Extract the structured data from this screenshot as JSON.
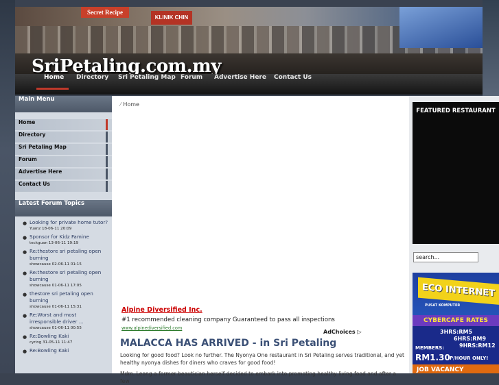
{
  "site": {
    "logo": "SriPetaling.com.my"
  },
  "header_signs": {
    "sign1": "Secret Recipe",
    "sign2": "KLINIK CHIN"
  },
  "nav": [
    {
      "label": "Home",
      "active": true
    },
    {
      "label": "Directory"
    },
    {
      "label": "Sri Petaling Map"
    },
    {
      "label": "Forum"
    },
    {
      "label": "Advertise Here"
    },
    {
      "label": "Contact Us"
    }
  ],
  "main_menu": {
    "heading": "Main Menu",
    "items": [
      "Home",
      "Directory",
      "Sri Petaling Map",
      "Forum",
      "Advertise Here",
      "Contact Us"
    ]
  },
  "forum": {
    "heading": "Latest Forum Topics",
    "topics": [
      {
        "title": "Looking for private home tutor?",
        "meta": "Yuanz 18-06-11 20:09"
      },
      {
        "title": "Sponsor for Kidz Famine",
        "meta": "teckguan 13-06-11 19:19"
      },
      {
        "title": "Re:thestore sri petaling open burning",
        "meta": "showcause 02-06-11 01:15"
      },
      {
        "title": "Re:thestore sri petaling open burning",
        "meta": "showcause 01-06-11 17:05"
      },
      {
        "title": "thestore sri petaling open burning",
        "meta": "showcause 01-06-11 15:31"
      },
      {
        "title": "Re:Worst and most irresponsible driver ...",
        "meta": "showcause 01-06-11 00:55"
      },
      {
        "title": "Re:Bowling Kaki",
        "meta": "cyring 31-05-11 11:47"
      },
      {
        "title": "Re:Bowling Kaki",
        "meta": ""
      }
    ]
  },
  "breadcrumb": "Home",
  "ad": {
    "title": "Alpine Diversified Inc.",
    "desc": "#1 recommended cleaning company Guaranteed to pass all inspections",
    "url": "www.alpinediversified.com",
    "adchoices": "AdChoices"
  },
  "article": {
    "title": "MALACCA HAS ARRIVED - in Sri Petaling",
    "body": "Looking for good food? Look no further. The Nyonya One restaurant in Sri Petaling serves traditional, and yet healthy nyonya dishes for diners who craves for good food!",
    "body2": "Mdm. Leong a former beautician herself decided to embark into promoting healthy living food and after a few"
  },
  "right": {
    "featured_label": "FEATURED RESTAURANT",
    "search_value": "search...",
    "promo": {
      "eco": "ECO INTERNET",
      "pusat": "PUSAT KOMPUTER",
      "rates": "CYBERCAFE RATES",
      "r1": "3HRS:RM5",
      "r2": "6HRS:RM9",
      "r3": "9HRS:RM12",
      "members": "MEMBERS:",
      "price": "RM1.30",
      "perhour": "P/HOUR ONLY!",
      "job": "JOB VACANCY"
    }
  }
}
